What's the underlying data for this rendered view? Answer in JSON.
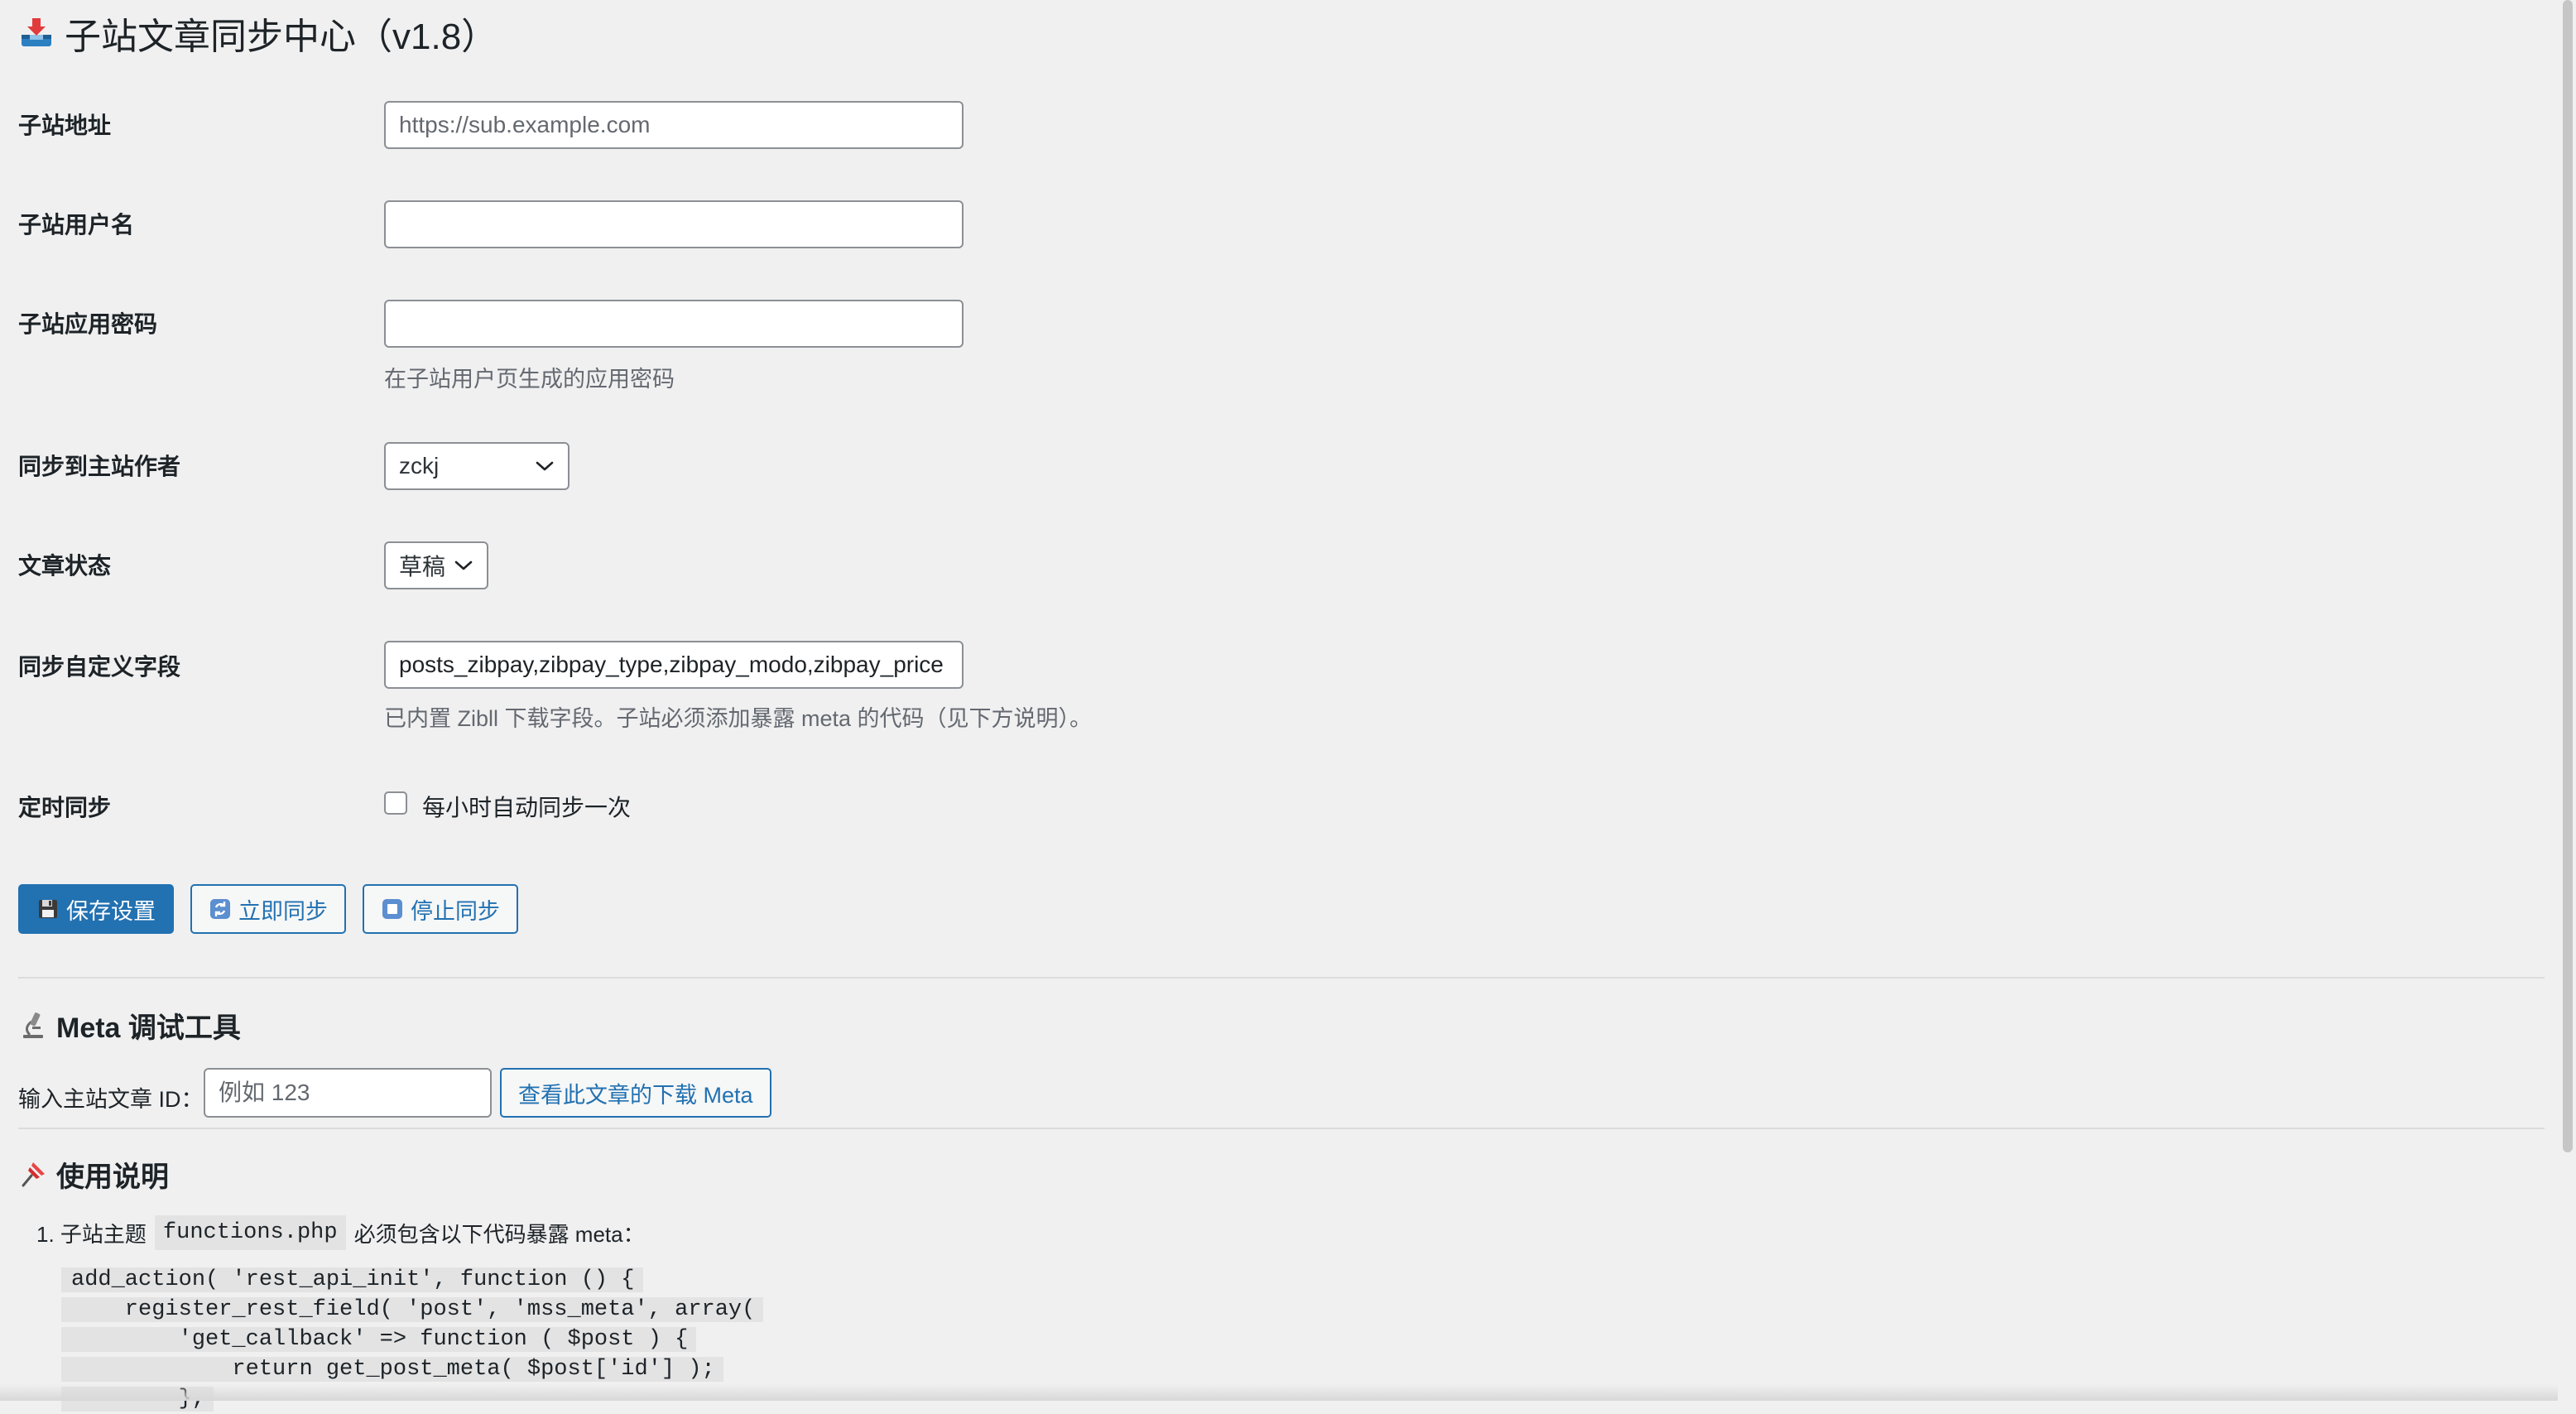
{
  "page": {
    "title": "子站文章同步中心（v1.8）",
    "title_icon": "inbox-tray-icon"
  },
  "settings": {
    "site_url": {
      "label": "子站地址",
      "placeholder": "https://sub.example.com",
      "value": ""
    },
    "username": {
      "label": "子站用户名",
      "value": ""
    },
    "app_password": {
      "label": "子站应用密码",
      "value": "",
      "description": "在子站用户页生成的应用密码"
    },
    "author": {
      "label": "同步到主站作者",
      "selected": "zckj"
    },
    "post_status": {
      "label": "文章状态",
      "selected": "草稿"
    },
    "custom_fields": {
      "label": "同步自定义字段",
      "value": "posts_zibpay,zibpay_type,zibpay_modo,zibpay_price",
      "description": "已内置 Zibll 下载字段。子站必须添加暴露 meta 的代码（见下方说明）。"
    },
    "schedule": {
      "label": "定时同步",
      "checkbox_label": "每小时自动同步一次",
      "checked": false
    }
  },
  "buttons": {
    "save": {
      "label": "保存设置",
      "icon": "floppy-disk-icon"
    },
    "sync_now": {
      "label": "立即同步",
      "icon": "refresh-icon"
    },
    "stop_sync": {
      "label": "停止同步",
      "icon": "stop-icon"
    }
  },
  "meta_debug": {
    "title": "Meta 调试工具",
    "icon": "microscope-icon",
    "input_label": "输入主站文章 ID：",
    "input_placeholder": "例如 123",
    "button_label": "查看此文章的下载 Meta"
  },
  "instructions": {
    "title": "使用说明",
    "icon": "pushpin-icon",
    "item1_prefix": "1. 子站主题",
    "item1_code": "functions.php",
    "item1_suffix": "必须包含以下代码暴露 meta：",
    "code_lines": [
      "add_action( 'rest_api_init', function () {",
      "    register_rest_field( 'post', 'mss_meta', array(",
      "        'get_callback' => function ( $post ) {",
      "            return get_post_meta( $post['id'] );",
      "        },"
    ]
  },
  "colors": {
    "primary": "#2271b1",
    "background": "#f0f0f1",
    "text": "#1d2327",
    "muted": "#646970",
    "border": "#8c8f94"
  }
}
